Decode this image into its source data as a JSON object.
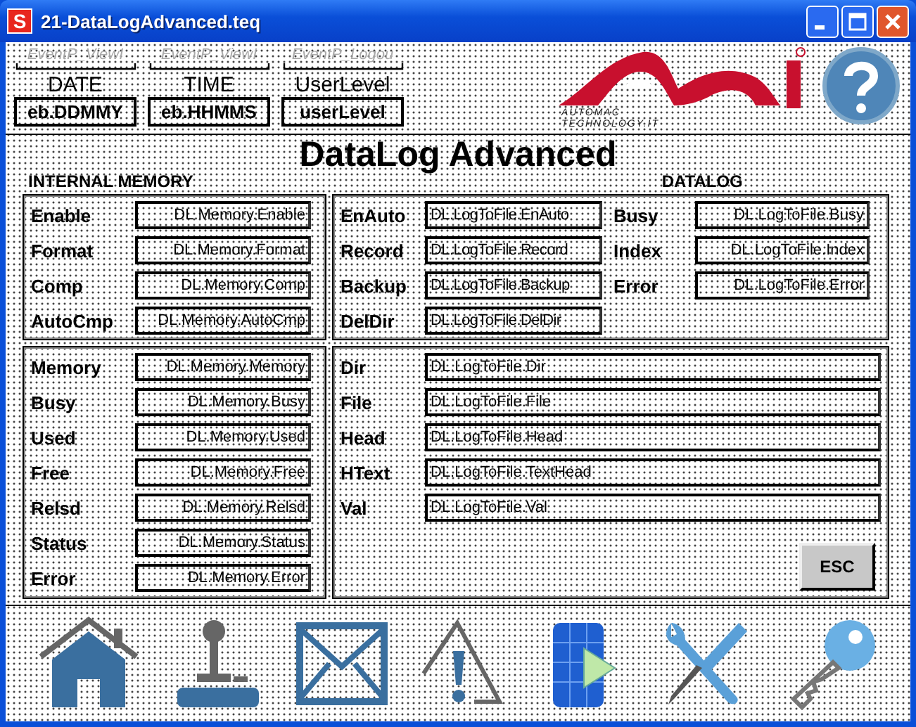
{
  "window": {
    "title": "21-DataLogAdvanced.teq",
    "icon_letter": "S"
  },
  "header": {
    "events": [
      "EventP_ViewI",
      "EventP_ViewI",
      "EventP_Logou"
    ],
    "fields": [
      {
        "label": "DATE",
        "value": "eb.DDMMY"
      },
      {
        "label": "TIME",
        "value": "eb.HHMMS"
      },
      {
        "label": "UserLevel",
        "value": "userLevel"
      }
    ],
    "logo": {
      "line_1": "AUTOMAC",
      "line_2": "TECHNOLOGY.IT"
    }
  },
  "title": "DataLog Advanced",
  "sections": {
    "internal_memory": "INTERNAL MEMORY",
    "datalog": "DATALOG"
  },
  "memory_controls": [
    {
      "label": "Enable",
      "value": "DL.Memory.Enable"
    },
    {
      "label": "Format",
      "value": "DL.Memory.Format"
    },
    {
      "label": "Comp",
      "value": "DL.Memory.Comp"
    },
    {
      "label": "AutoCmp",
      "value": "DL.Memory.AutoCmp"
    }
  ],
  "datalog_controls": [
    {
      "label": "EnAuto",
      "value": "DL.LogToFile.EnAuto"
    },
    {
      "label": "Record",
      "value": "DL.LogToFile.Record"
    },
    {
      "label": "Backup",
      "value": "DL.LogToFile.Backup"
    },
    {
      "label": "DelDir",
      "value": "DL.LogToFile.DelDir"
    }
  ],
  "datalog_status": [
    {
      "label": "Busy",
      "value": "DL.LogToFile.Busy"
    },
    {
      "label": "Index",
      "value": "DL.LogToFile.Index"
    },
    {
      "label": "Error",
      "value": "DL.LogToFile.Error"
    }
  ],
  "memory_status": [
    {
      "label": "Memory",
      "value": "DL.Memory.Memory"
    },
    {
      "label": "Busy",
      "value": "DL.Memory.Busy"
    },
    {
      "label": "Used",
      "value": "DL.Memory.Used"
    },
    {
      "label": "Free",
      "value": "DL.Memory.Free"
    },
    {
      "label": "Relsd",
      "value": "DL.Memory.Relsd"
    },
    {
      "label": "Status",
      "value": "DL.Memory.Status"
    },
    {
      "label": "Error",
      "value": "DL.Memory.Error"
    }
  ],
  "datalog_paths": [
    {
      "label": "Dir",
      "value": "DL.LogToFile.Dir"
    },
    {
      "label": "File",
      "value": "DL.LogToFile.File"
    },
    {
      "label": "Head",
      "value": "DL.LogToFile.Head"
    },
    {
      "label": "HText",
      "value": "DL.LogToFile.TextHead"
    },
    {
      "label": "Val",
      "value": "DL.LogToFile.Val"
    }
  ],
  "esc_button": "ESC"
}
